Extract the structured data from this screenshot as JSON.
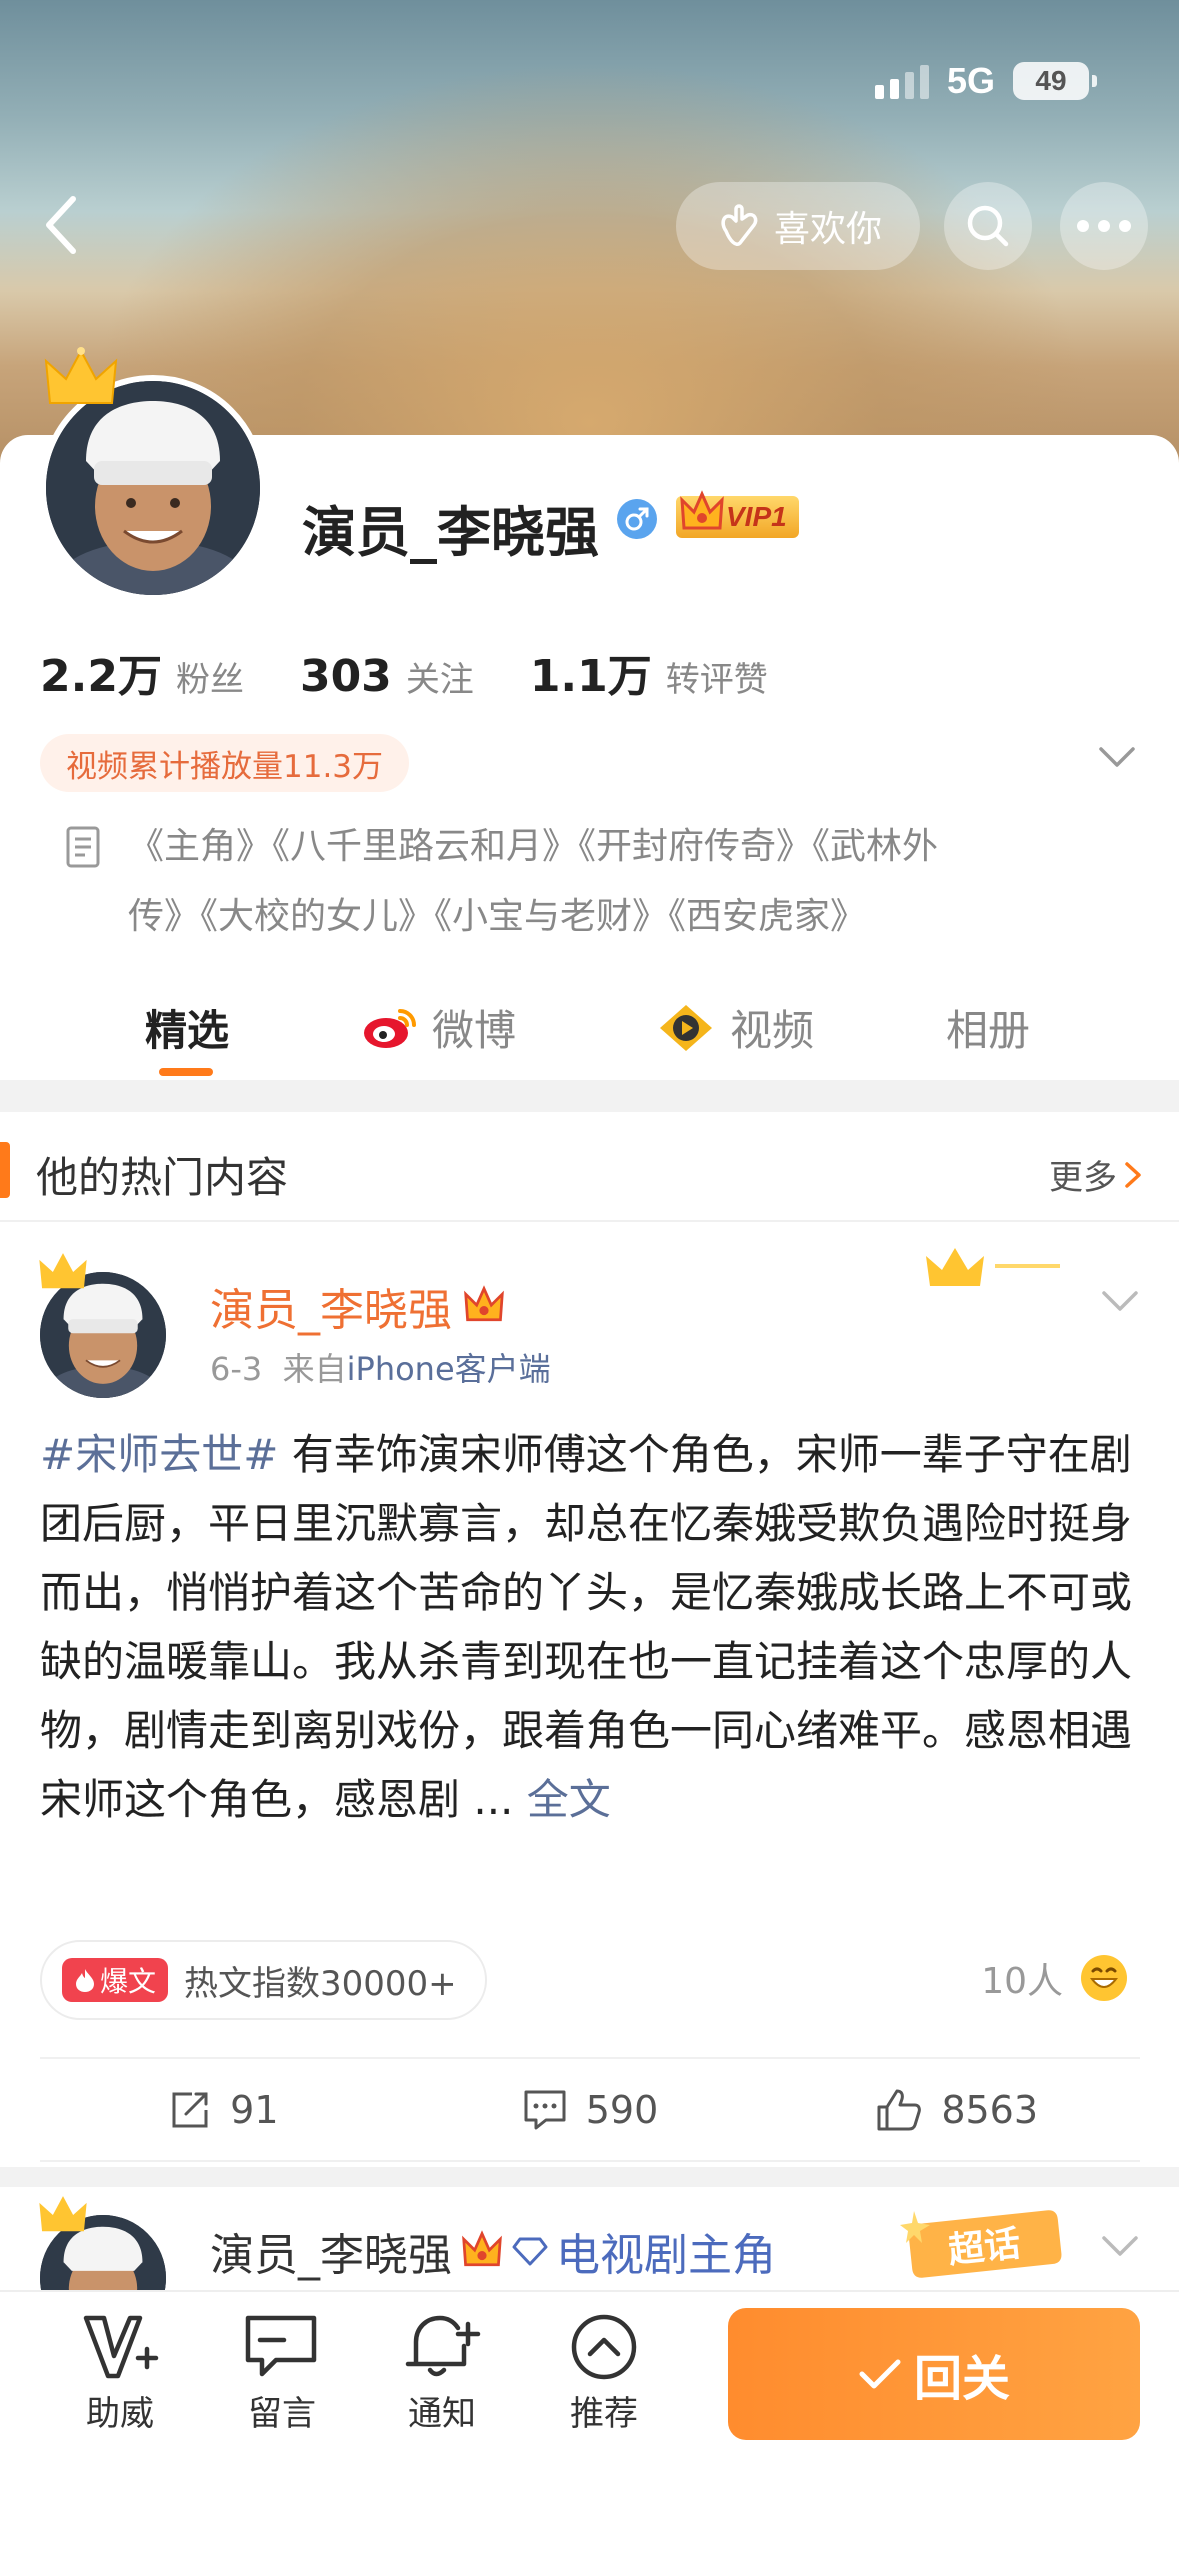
{
  "status_bar": {
    "network": "5G",
    "battery": "49"
  },
  "header": {
    "like_label": "喜欢你"
  },
  "profile": {
    "name": "演员_李晓强",
    "vip_label": "VIP1",
    "stats": [
      {
        "value": "2.2万",
        "label": "粉丝"
      },
      {
        "value": "303",
        "label": "关注"
      },
      {
        "value": "1.1万",
        "label": "转评赞"
      }
    ],
    "video_badge": "视频累计播放量11.3万",
    "works_line1": "《主角》《八千里路云和月》《开封府传奇》《武林外",
    "works_line2": "传》《大校的女儿》《小宝与老财》《西安虎家》"
  },
  "tabs": [
    {
      "label": "精选"
    },
    {
      "label": "微博"
    },
    {
      "label": "视频"
    },
    {
      "label": "相册"
    }
  ],
  "hot_section": {
    "title": "他的热门内容",
    "more_label": "更多"
  },
  "post": {
    "author": "演员_李晓强",
    "date": "6-3",
    "from_label": "来自",
    "source": "iPhone客户端",
    "topic": "#宋师去世#",
    "body_line1": " 有幸饰演宋师傅这个角色，宋师一辈子",
    "body_rest": "守在剧团后厨，平日里沉默寡言，却总在忆秦娥受欺负遇险时挺身而出，悄悄护着这个苦命的丫头，是忆秦娥成长路上不可或缺的温暖靠山。我从杀青到现在也一直记挂着这个忠厚的人物，剧情走到离别戏份，跟着角色一同心绪难平。感恩相遇宋师这个角色，感恩剧 ... ",
    "fulltext_label": "全文",
    "hot_tag": "爆文",
    "hot_index": "热文指数30000+",
    "readers": "10人",
    "reposts": "91",
    "comments": "590",
    "likes": "8563"
  },
  "post2": {
    "author": "演员_李晓强",
    "role": "电视剧主角",
    "badge": "超话"
  },
  "bottom_nav": {
    "items": [
      {
        "label": "助威"
      },
      {
        "label": "留言"
      },
      {
        "label": "通知"
      },
      {
        "label": "推荐"
      }
    ],
    "follow_label": "回关"
  },
  "colors": {
    "accent": "#ff7a1a",
    "link": "#5b6f98",
    "name_orange": "#ef7033"
  }
}
